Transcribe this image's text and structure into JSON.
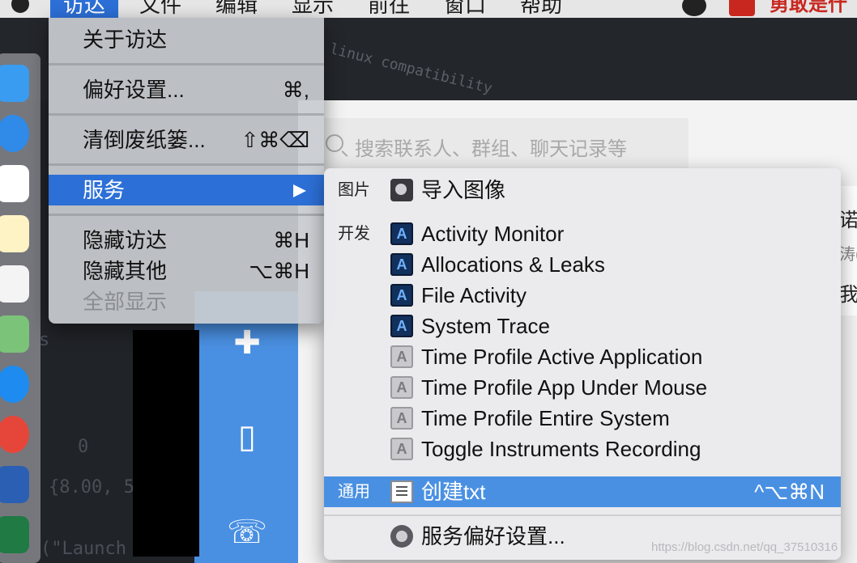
{
  "menubar": {
    "items": [
      "访达",
      "文件",
      "编辑",
      "显示",
      "前往",
      "窗口",
      "帮助"
    ],
    "right_text": "勇敢是什"
  },
  "background": {
    "code_snippet": "linux compatibility",
    "code_fragments": [
      "s",
      "0",
      "{8.00, 5",
      "(\"Launch"
    ]
  },
  "app": {
    "search_placeholder": "搜索联系人、群组、聊天记录等",
    "right_fragments": [
      "诺浏",
      "涛(",
      "我"
    ]
  },
  "finder_menu": {
    "about": "关于访达",
    "preferences": "偏好设置...",
    "preferences_shortcut": "⌘,",
    "empty_trash": "清倒废纸篓...",
    "empty_trash_shortcut": "⇧⌘⌫",
    "services": "服务",
    "hide": "隐藏访达",
    "hide_shortcut": "⌘H",
    "hide_others": "隐藏其他",
    "hide_others_shortcut": "⌥⌘H",
    "show_all": "全部显示"
  },
  "services_menu": {
    "cat_pictures": "图片",
    "import_image": "导入图像",
    "cat_development": "开发",
    "dev_items": [
      "Activity Monitor",
      "Allocations & Leaks",
      "File Activity",
      "System Trace",
      "Time Profile Active Application",
      "Time Profile App Under Mouse",
      "Time Profile Entire System",
      "Toggle Instruments Recording"
    ],
    "cat_general": "通用",
    "create_txt": "创建txt",
    "create_txt_shortcut": "^⌥⌘N",
    "services_prefs": "服务偏好设置..."
  },
  "watermark": "https://blog.csdn.net/qq_37510316"
}
